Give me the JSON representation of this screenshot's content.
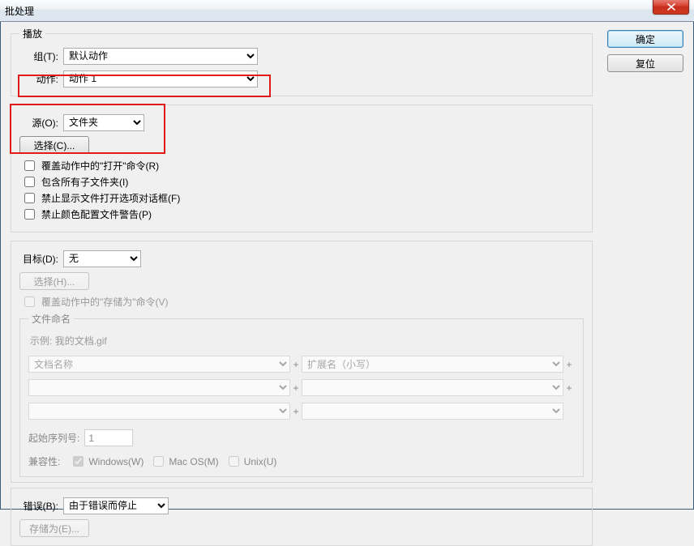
{
  "window": {
    "title": "批处理"
  },
  "buttons": {
    "ok": "确定",
    "reset": "复位",
    "choose_source": "选择(C)...",
    "choose_dest": "选择(H)...",
    "save_as_err": "存储为(E)..."
  },
  "play": {
    "legend": "播放",
    "group_label": "组(T):",
    "group_value": "默认动作",
    "action_label": "动作:",
    "action_value": "动作 1"
  },
  "source": {
    "label": "源(O):",
    "value": "文件夹",
    "override_open": "覆盖动作中的\"打开\"命令(R)",
    "include_sub": "包含所有子文件夹(I)",
    "suppress_open_dialog": "禁止显示文件打开选项对话框(F)",
    "suppress_color_warn": "禁止颜色配置文件警告(P)"
  },
  "dest": {
    "label": "目标(D):",
    "value": "无",
    "override_save": "覆盖动作中的\"存储为\"命令(V)"
  },
  "naming": {
    "legend": "文件命名",
    "example_label": "示例:",
    "example_value": "我的文档.gif",
    "slot1": "文档名称",
    "slot2": "扩展名（小写）",
    "slot3": "",
    "slot4": "",
    "slot5": "",
    "slot6": "",
    "plus": "+",
    "serial_label": "起始序列号:",
    "serial_value": "1",
    "compat_label": "兼容性:",
    "compat_win": "Windows(W)",
    "compat_mac": "Mac OS(M)",
    "compat_unix": "Unix(U)"
  },
  "error": {
    "label": "错误(B):",
    "value": "由于错误而停止"
  }
}
